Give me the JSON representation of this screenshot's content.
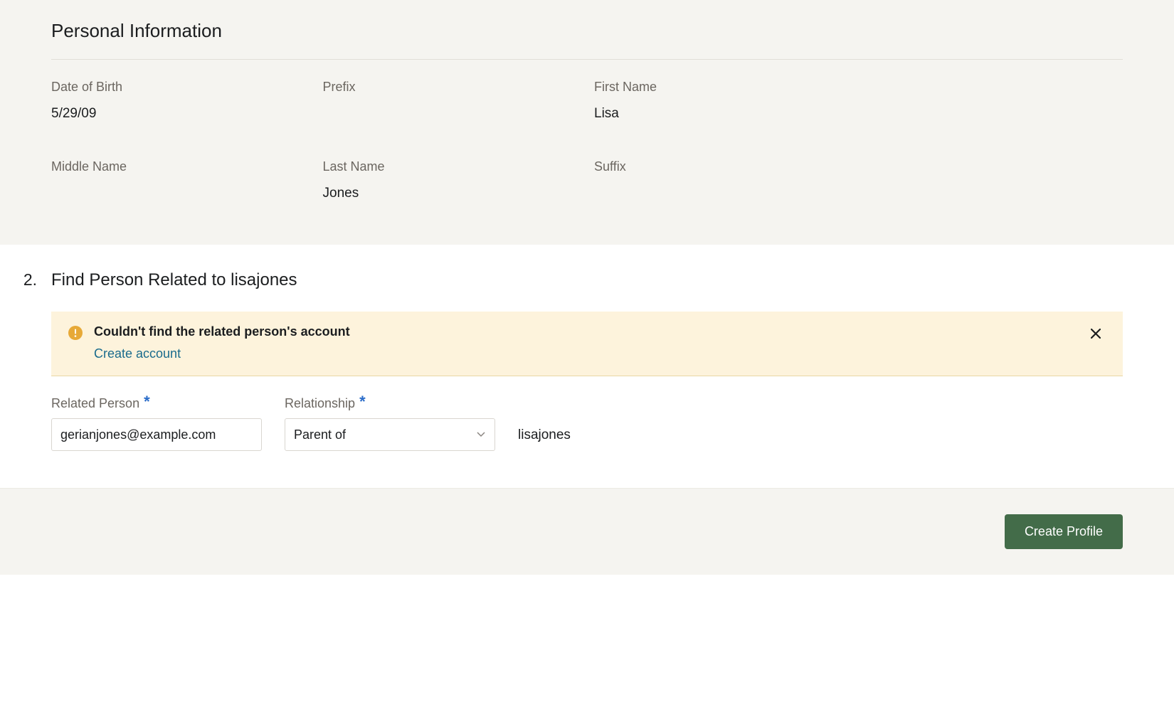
{
  "personal": {
    "heading": "Personal Information",
    "fields": {
      "dob_label": "Date of Birth",
      "dob_value": "5/29/09",
      "prefix_label": "Prefix",
      "prefix_value": "",
      "first_name_label": "First Name",
      "first_name_value": "Lisa",
      "middle_name_label": "Middle Name",
      "middle_name_value": "",
      "last_name_label": "Last Name",
      "last_name_value": "Jones",
      "suffix_label": "Suffix",
      "suffix_value": ""
    }
  },
  "step": {
    "number": "2.",
    "title": "Find Person Related to lisajones"
  },
  "alert": {
    "title": "Couldn't find the related person's account",
    "link_label": "Create account"
  },
  "form": {
    "related_person_label": "Related Person",
    "related_person_value": "gerianjones@example.com",
    "relationship_label": "Relationship",
    "relationship_value": "Parent of",
    "relation_target": "lisajones",
    "required_mark": "*"
  },
  "footer": {
    "create_profile_label": "Create Profile"
  }
}
